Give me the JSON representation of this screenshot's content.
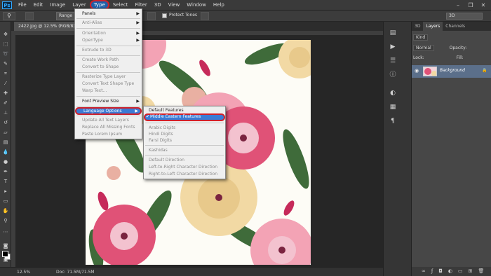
{
  "app": {
    "logo": "Ps"
  },
  "menubar": {
    "items": [
      "File",
      "Edit",
      "Image",
      "Layer",
      "Type",
      "Select",
      "Filter",
      "3D",
      "View",
      "Window",
      "Help"
    ],
    "active": "Type"
  },
  "options": {
    "range_label": "Range",
    "protect_tones": "Protect Tones",
    "workspace": "3D"
  },
  "document": {
    "tab_title": "2422.jpg @ 12.5% (RGB/8)"
  },
  "status": {
    "zoom": "12.5%",
    "doc": "Doc: 71.5M/71.5M"
  },
  "type_menu": {
    "items": [
      {
        "label": "Panels",
        "has_submenu": true,
        "disabled": false
      },
      {
        "label": "Anti-Alias",
        "has_submenu": true,
        "disabled": true
      },
      {
        "label": "Orientation",
        "has_submenu": true,
        "disabled": true
      },
      {
        "label": "OpenType",
        "has_submenu": true,
        "disabled": true
      },
      {
        "label": "Extrude to 3D",
        "has_submenu": false,
        "disabled": true
      },
      {
        "label": "Create Work Path",
        "has_submenu": false,
        "disabled": true
      },
      {
        "label": "Convert to Shape",
        "has_submenu": false,
        "disabled": true
      },
      {
        "label": "Rasterize Type Layer",
        "has_submenu": false,
        "disabled": true
      },
      {
        "label": "Convert Text Shape Type",
        "has_submenu": false,
        "disabled": true
      },
      {
        "label": "Warp Text...",
        "has_submenu": false,
        "disabled": true
      },
      {
        "label": "Font Preview Size",
        "has_submenu": true,
        "disabled": false
      },
      {
        "label": "Language Options",
        "has_submenu": true,
        "disabled": false,
        "highlighted": true
      },
      {
        "label": "Update All Text Layers",
        "has_submenu": false,
        "disabled": true
      },
      {
        "label": "Replace All Missing Fonts",
        "has_submenu": false,
        "disabled": true
      },
      {
        "label": "Paste Lorem Ipsum",
        "has_submenu": false,
        "disabled": true
      }
    ]
  },
  "language_submenu": {
    "items": [
      {
        "label": "Default Features",
        "checked": false,
        "disabled": false
      },
      {
        "label": "Middle Eastern Features",
        "checked": true,
        "disabled": false,
        "highlighted": true
      },
      {
        "label": "Arabic Digits",
        "checked": false,
        "disabled": true
      },
      {
        "label": "Hindi Digits",
        "checked": false,
        "disabled": true
      },
      {
        "label": "Farsi Digits",
        "checked": false,
        "disabled": true
      },
      {
        "label": "Kashidas",
        "checked": false,
        "disabled": true
      },
      {
        "label": "Default Direction",
        "checked": false,
        "disabled": true
      },
      {
        "label": "Left-to-Right Character Direction",
        "checked": false,
        "disabled": true
      },
      {
        "label": "Right-to-Left Character Direction",
        "checked": false,
        "disabled": true
      }
    ]
  },
  "layers_panel": {
    "tabs": [
      "3D",
      "Layers",
      "Channels"
    ],
    "active_tab": "Layers",
    "filter_kind": "Kind",
    "blend_mode": "Normal",
    "opacity_label": "Opacity:",
    "lock_label": "Lock:",
    "fill_label": "Fill:",
    "layer_name": "Background"
  },
  "colors": {
    "accent": "#3a7bd5",
    "highlight_ring": "#d0202a",
    "artwork_bg": "#fdfcf6"
  }
}
